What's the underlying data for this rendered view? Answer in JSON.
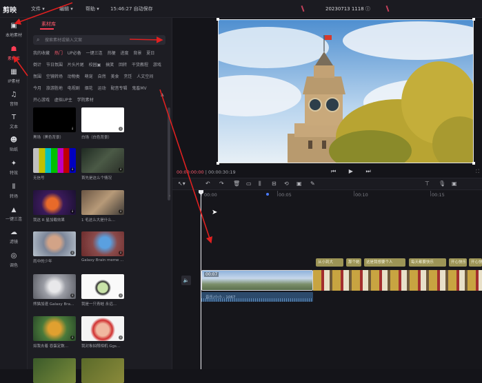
{
  "app": {
    "logo": "剪映"
  },
  "menu": [
    {
      "label": "文件 ▾"
    },
    {
      "label": "编辑 ▾"
    },
    {
      "label": "帮助 ▾"
    },
    {
      "label": "15:46:27 自动保存"
    }
  ],
  "project_title": "20230713 1118 ⓘ",
  "rail": [
    {
      "label": "本地素材",
      "icon": "folder-icon",
      "glyph": "▣"
    },
    {
      "label": "素材库",
      "icon": "library-icon",
      "glyph": "☗",
      "active": true
    },
    {
      "label": "IP素材",
      "icon": "robot-icon",
      "glyph": "▦"
    },
    {
      "label": "音频",
      "icon": "music-icon",
      "glyph": "♫"
    },
    {
      "label": "文本",
      "icon": "text-icon",
      "glyph": "T"
    },
    {
      "label": "贴纸",
      "icon": "sticker-icon",
      "glyph": "☻"
    },
    {
      "label": "特效",
      "icon": "effect-icon",
      "glyph": "✦"
    },
    {
      "label": "转场",
      "icon": "transition-icon",
      "glyph": "⫴"
    },
    {
      "label": "一键三连",
      "icon": "thumbs-up-icon",
      "glyph": "👍"
    },
    {
      "label": "滤镜",
      "icon": "filter-icon",
      "glyph": "☁"
    },
    {
      "label": "调色",
      "icon": "palette-icon",
      "glyph": "◎"
    }
  ],
  "library": {
    "tab": "素材库",
    "search_placeholder": "搜索素材或输入文案",
    "categories": [
      {
        "label": "我的收藏"
      },
      {
        "label": "热门",
        "active": true
      },
      {
        "label": "UP必备"
      },
      {
        "label": "一键三连"
      },
      {
        "label": "热梗"
      },
      {
        "label": "进度"
      },
      {
        "label": "背景"
      },
      {
        "label": "夏日"
      },
      {
        "label": "倒计"
      },
      {
        "label": "节日氛围"
      },
      {
        "label": "片头片尾"
      },
      {
        "label": "校园▣"
      },
      {
        "label": "搞笑"
      },
      {
        "label": "回转"
      },
      {
        "label": "干货教程"
      },
      {
        "label": "游戏"
      },
      {
        "label": "氛围"
      },
      {
        "label": "空镜转场"
      },
      {
        "label": "动物类"
      },
      {
        "label": "萌宠"
      },
      {
        "label": "自然"
      },
      {
        "label": "美食"
      },
      {
        "label": "烹饪"
      },
      {
        "label": "人文空间"
      },
      {
        "label": "今月"
      },
      {
        "label": "旅游胜地"
      },
      {
        "label": "电视剧"
      },
      {
        "label": "烟花"
      },
      {
        "label": "运动"
      },
      {
        "label": "配音专辑"
      },
      {
        "label": "鬼畜MV"
      },
      {
        "label": "开心游戏"
      },
      {
        "label": "虚拟UP主"
      },
      {
        "label": "学院素材"
      }
    ],
    "collapse_glyph": "▲",
    "items": [
      {
        "caption": "黑场（黑色背景）"
      },
      {
        "caption": "白场（白色背景）"
      },
      {
        "caption": "无信号"
      },
      {
        "caption": "首先是这么个情况"
      },
      {
        "caption": "我这 R 星加载效果"
      },
      {
        "caption": "1 毛这么大是什么..."
      },
      {
        "caption": "雨中的少年"
      },
      {
        "caption": "Galaxy Brain meme ..."
      },
      {
        "caption": "熊猫加速 Galaxy Bra..."
      },
      {
        "caption": "我是一只青蛙 永远..."
      },
      {
        "caption": "如我去着 吞蛋定数..."
      },
      {
        "caption": "我对象拍照相机 Ggs..."
      }
    ]
  },
  "preview": {
    "timecode_current": "00:00:00:00",
    "timecode_total": "00:00:30:19",
    "controls": "⏮ ▶ ⏭"
  },
  "timeline": {
    "ticks": [
      "00:00",
      "00:05",
      "00:10",
      "00:15"
    ],
    "text_clips": [
      "从小到大",
      "那个她",
      "这是我想要个人",
      "每天都要快乐",
      "开心快乐",
      "开心快乐"
    ],
    "video_clip_label": "00:07",
    "audio_clip_label": "音乐/小小 - 1067"
  },
  "colors": {
    "accent": "#ff3d55",
    "text_clip": "#9c9456",
    "audio_clip": "#2c4a6b",
    "playhead": "#e8e8ec"
  }
}
